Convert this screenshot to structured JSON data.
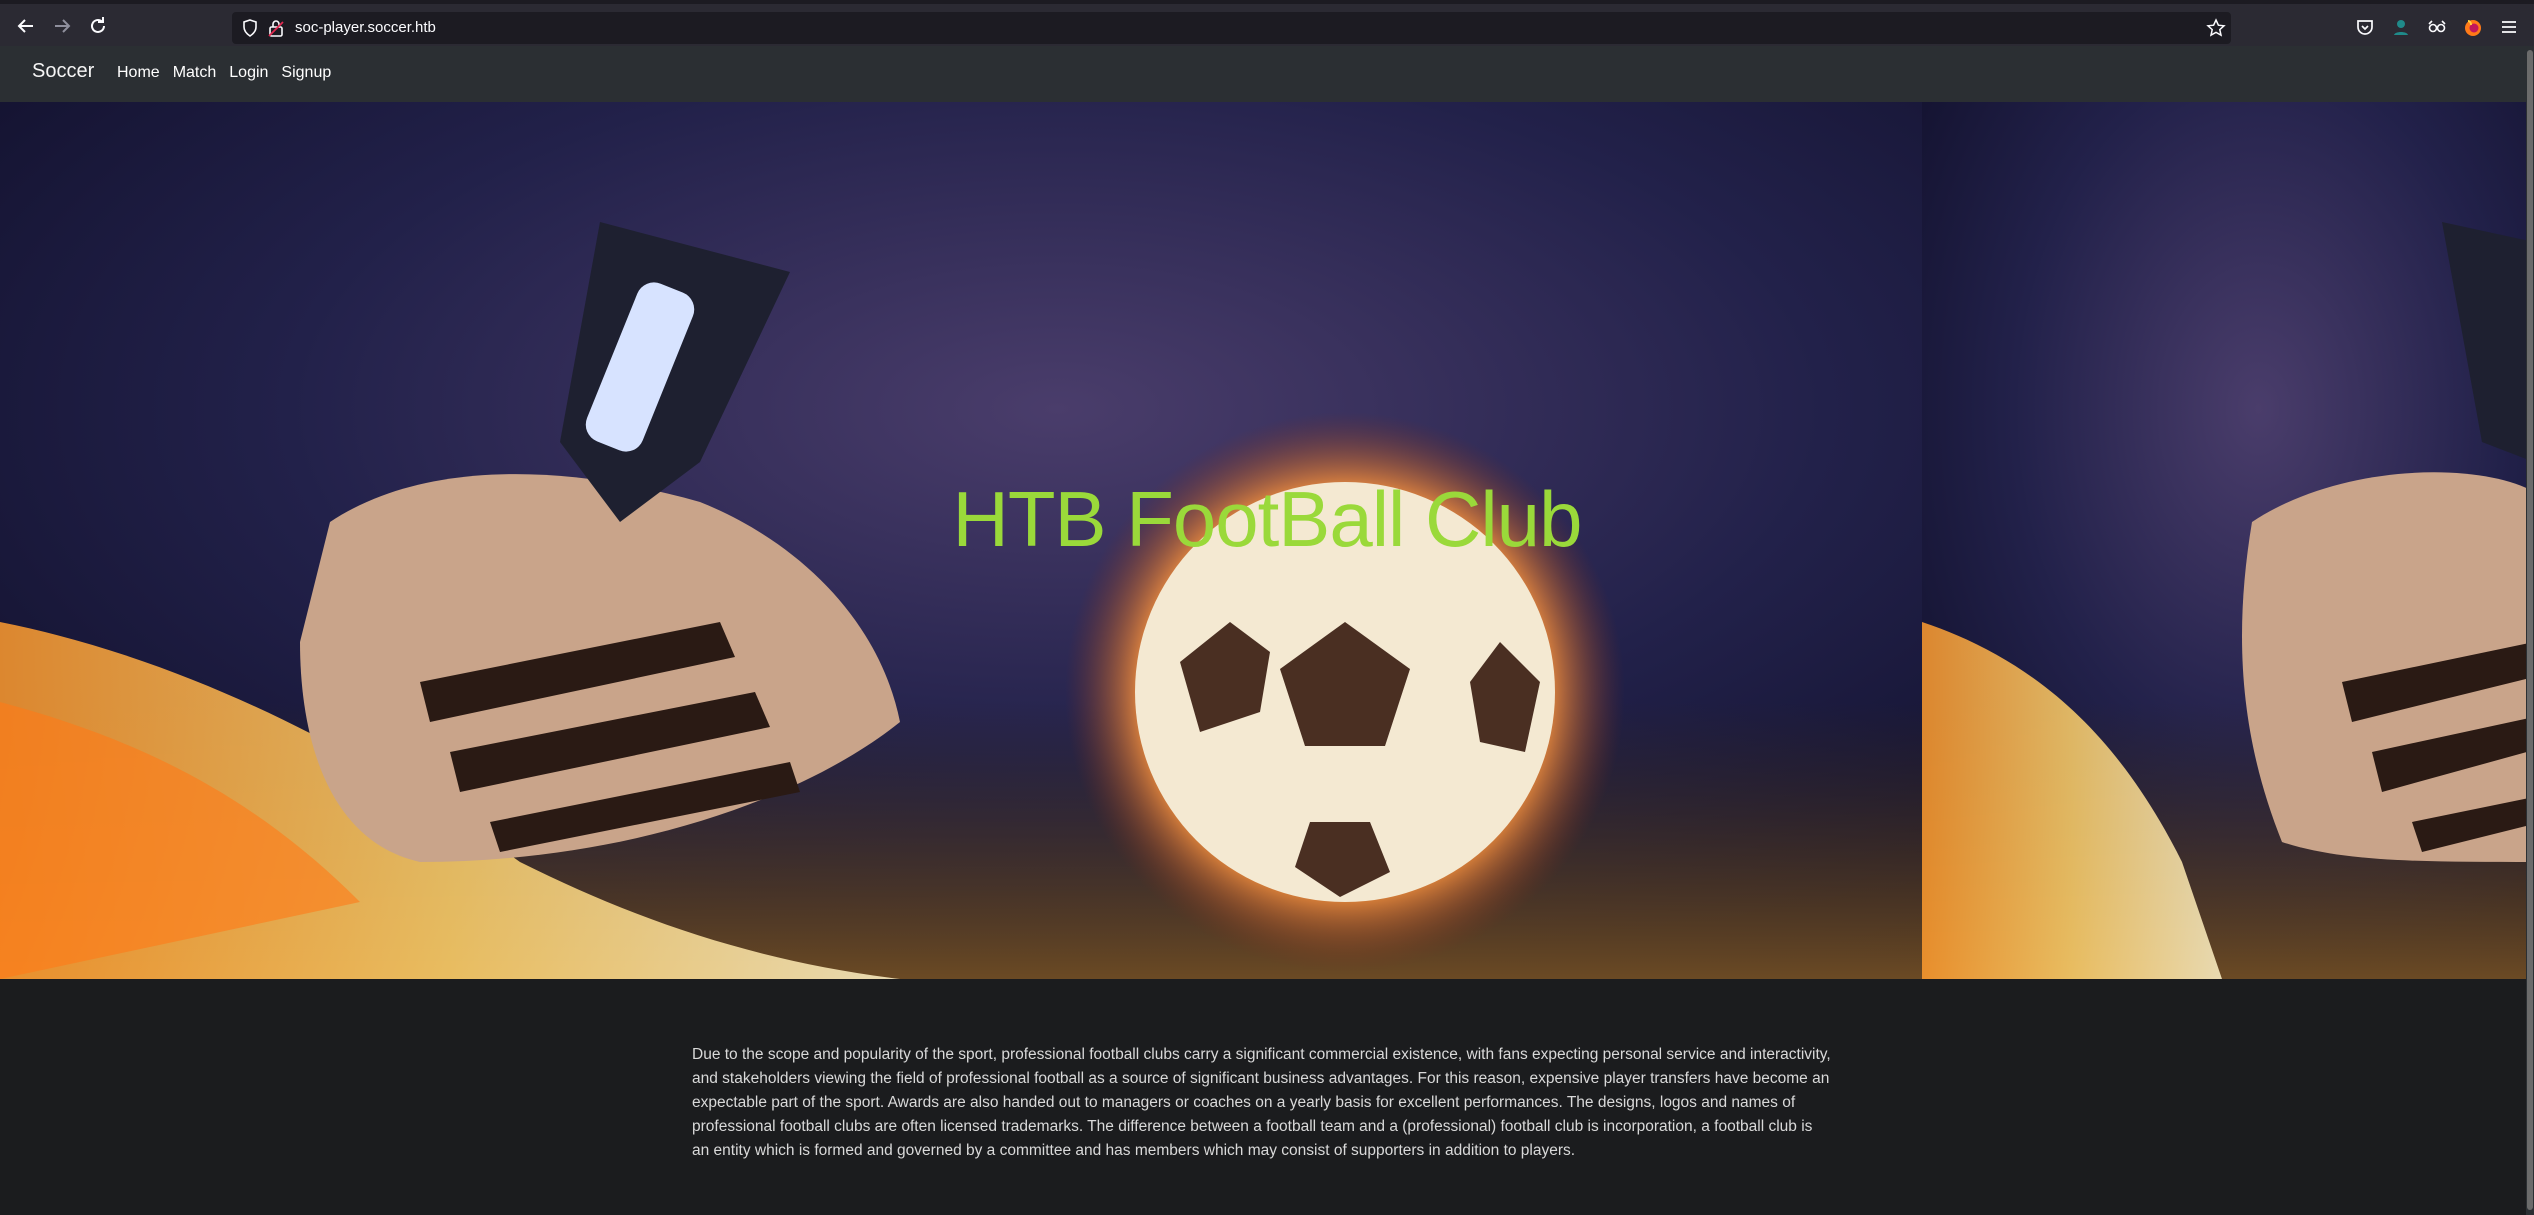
{
  "browser": {
    "url": "soc-player.soccer.htb",
    "icons": [
      "back-arrow-icon",
      "forward-arrow-icon",
      "reload-icon",
      "shield-icon",
      "lock-icon",
      "star-icon",
      "pocket-icon",
      "account-icon",
      "private-mask-icon",
      "firefox-icon",
      "menu-icon"
    ]
  },
  "site": {
    "brand": "Soccer",
    "nav": [
      {
        "label": "Home"
      },
      {
        "label": "Match"
      },
      {
        "label": "Login"
      },
      {
        "label": "Signup"
      }
    ]
  },
  "hero": {
    "title": "HTB FootBall Club",
    "subtitle": "",
    "title_color": "#9ad93a"
  },
  "content": {
    "paragraph": "Due to the scope and popularity of the sport, professional football clubs carry a significant commercial existence, with fans expecting personal service and interactivity, and stakeholders viewing the field of professional football as a source of significant business advantages. For this reason, expensive player transfers have become an expectable part of the sport. Awards are also handed out to managers or coaches on a yearly basis for excellent performances. The designs, logos and names of professional football clubs are often licensed trademarks. The difference between a football team and a (professional) football club is incorporation, a football club is an entity which is formed and governed by a committee and has members which may consist of supporters in addition to players."
  }
}
